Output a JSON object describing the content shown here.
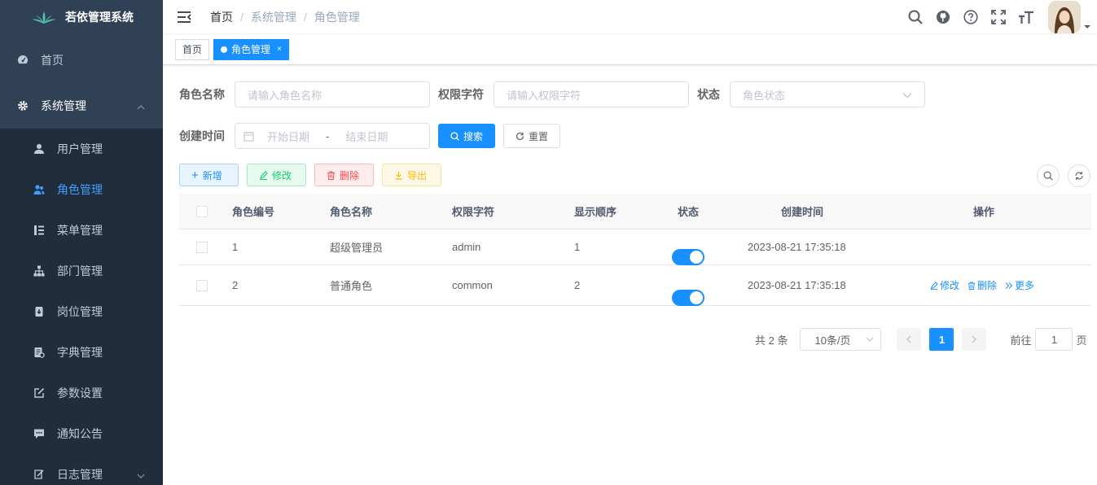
{
  "app": {
    "title": "若依管理系统"
  },
  "sidebar": {
    "home": "首页",
    "system": "系统管理",
    "items": [
      {
        "label": "用户管理",
        "icon": "user-icon"
      },
      {
        "label": "角色管理",
        "icon": "peoples-icon",
        "active": true
      },
      {
        "label": "菜单管理",
        "icon": "tree-table-icon"
      },
      {
        "label": "部门管理",
        "icon": "tree-icon"
      },
      {
        "label": "岗位管理",
        "icon": "post-icon"
      },
      {
        "label": "字典管理",
        "icon": "dict-icon"
      },
      {
        "label": "参数设置",
        "icon": "edit-icon"
      },
      {
        "label": "通知公告",
        "icon": "message-icon"
      }
    ],
    "log": "日志管理"
  },
  "breadcrumb": [
    "首页",
    "系统管理",
    "角色管理"
  ],
  "tags": {
    "home": "首页",
    "active": "角色管理",
    "close": "×"
  },
  "search": {
    "role_name_label": "角色名称",
    "role_name_placeholder": "请输入角色名称",
    "role_key_label": "权限字符",
    "role_key_placeholder": "请输入权限字符",
    "status_label": "状态",
    "status_placeholder": "角色状态",
    "date_label": "创建时间",
    "start_placeholder": "开始日期",
    "range_sep": "-",
    "end_placeholder": "结束日期",
    "search_btn": "搜索",
    "reset_btn": "重置"
  },
  "toolbar": {
    "add": "新增",
    "edit": "修改",
    "delete": "删除",
    "export": "导出"
  },
  "table": {
    "columns": [
      "角色编号",
      "角色名称",
      "权限字符",
      "显示顺序",
      "状态",
      "创建时间",
      "操作"
    ],
    "rows": [
      {
        "id": "1",
        "name": "超级管理员",
        "key": "admin",
        "sort": "1",
        "status": true,
        "created": "2023-08-21 17:35:18"
      },
      {
        "id": "2",
        "name": "普通角色",
        "key": "common",
        "sort": "2",
        "status": true,
        "created": "2023-08-21 17:35:18"
      }
    ],
    "ops": {
      "edit": "修改",
      "delete": "删除",
      "more": "更多"
    }
  },
  "pagination": {
    "total": "共 2 条",
    "size": "10条/页",
    "current": "1",
    "goto": "前往",
    "goto_value": "1",
    "page_unit": "页"
  },
  "colors": {
    "sidebar_bg": "#304156",
    "submenu_bg": "#1f2d3d",
    "primary": "#1890ff",
    "success": "#13ce66",
    "danger": "#ff4949",
    "warning": "#ffba00"
  }
}
